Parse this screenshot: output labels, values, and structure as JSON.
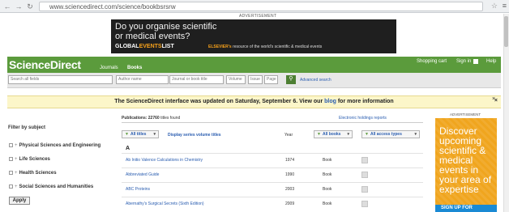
{
  "browser": {
    "url": "www.sciencedirect.com/science/bookbsrsrw"
  },
  "top_ad": {
    "label": "ADVERTISEMENT",
    "line1": "Do you organise scientific",
    "line2": "or medical events?",
    "brand_a": "GLOBAL",
    "brand_b": "EVENTS",
    "brand_c": "LIST",
    "tag_brand": "ELSEVIER's",
    "tag_text": " resource of the world's scientific & medical events"
  },
  "header": {
    "logo": "ScienceDirect",
    "nav": [
      "Journals",
      "Books"
    ],
    "cart": "Shopping cart",
    "signin": "Sign in",
    "help": "Help"
  },
  "search": {
    "all_fields": "Search all fields",
    "author": "Author name",
    "journal": "Journal or book title",
    "volume": "Volume",
    "issue": "Issue",
    "page": "Page",
    "advanced": "Advanced search"
  },
  "notice": {
    "text_before": "The ScienceDirect interface was updated on Saturday, September 6. View our ",
    "link": "blog",
    "text_after": " for more information",
    "close": "×"
  },
  "filter": {
    "title": "Filter by subject",
    "subjects": [
      "Physical Sciences and Engineering",
      "Life Sciences",
      "Health Sciences",
      "Social Sciences and Humanities"
    ],
    "apply": "Apply"
  },
  "listing": {
    "pubs_label": "Publications: 22760",
    "pubs_suffix": " titles found",
    "holdings": "Electronic holdings reports",
    "dd_titles": "All titles",
    "series": "Display series volume titles",
    "year_header": "Year",
    "dd_books": "All books",
    "dd_access": "All access types",
    "letter": "A",
    "rows": [
      {
        "title": "Ab Initio Valence Calculations in Chemistry",
        "year": "1974",
        "type": "Book"
      },
      {
        "title": "Abbreviated Guide",
        "year": "1990",
        "type": "Book"
      },
      {
        "title": "ABC Proteins",
        "year": "2003",
        "type": "Book"
      },
      {
        "title": "Abernathy's Surgical Secrets (Sixth Edition)",
        "year": "2009",
        "type": "Book"
      }
    ]
  },
  "right_ad": {
    "label": "ADVERTISEMENT",
    "close": "×",
    "lines": [
      "Discover",
      "upcoming",
      "scientific &",
      "medical",
      "events in",
      "your area of",
      "expertise"
    ],
    "cta": "SIGN UP FOR"
  }
}
